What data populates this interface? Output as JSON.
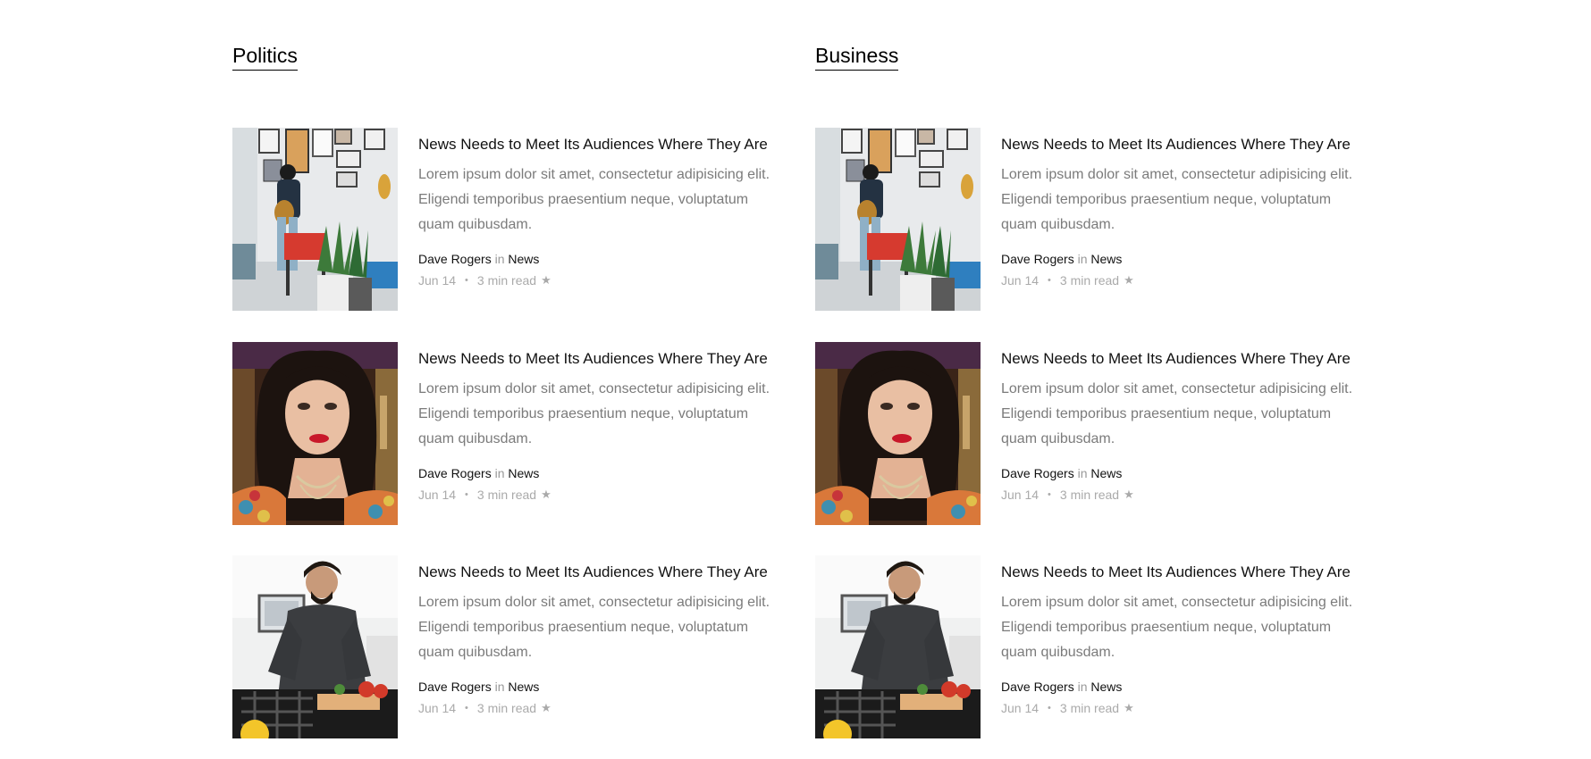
{
  "sections": [
    {
      "title": "Politics",
      "posts": [
        {
          "image": "woman-gallery-photo",
          "title": "News Needs to Meet Its Audiences Where They Are",
          "excerpt": "Lorem ipsum dolor sit amet, consectetur adipisicing elit. Eligendi temporibus praesentium neque, voluptatum quam quibusdam.",
          "author": "Dave Rogers",
          "in": "in",
          "category": "News",
          "date": "Jun 14",
          "separator": "•",
          "read_time": "3 min read",
          "star_icon": "star-icon"
        },
        {
          "image": "woman-portrait-photo",
          "title": "News Needs to Meet Its Audiences Where They Are",
          "excerpt": "Lorem ipsum dolor sit amet, consectetur adipisicing elit. Eligendi temporibus praesentium neque, voluptatum quam quibusdam.",
          "author": "Dave Rogers",
          "in": "in",
          "category": "News",
          "date": "Jun 14",
          "separator": "•",
          "read_time": "3 min read",
          "star_icon": "star-icon"
        },
        {
          "image": "man-cooking-photo",
          "title": "News Needs to Meet Its Audiences Where They Are",
          "excerpt": "Lorem ipsum dolor sit amet, consectetur adipisicing elit. Eligendi temporibus praesentium neque, voluptatum quam quibusdam.",
          "author": "Dave Rogers",
          "in": "in",
          "category": "News",
          "date": "Jun 14",
          "separator": "•",
          "read_time": "3 min read",
          "star_icon": "star-icon"
        }
      ]
    },
    {
      "title": "Business",
      "posts": [
        {
          "image": "woman-gallery-photo",
          "title": "News Needs to Meet Its Audiences Where They Are",
          "excerpt": "Lorem ipsum dolor sit amet, consectetur adipisicing elit. Eligendi temporibus praesentium neque, voluptatum quam quibusdam.",
          "author": "Dave Rogers",
          "in": "in",
          "category": "News",
          "date": "Jun 14",
          "separator": "•",
          "read_time": "3 min read",
          "star_icon": "star-icon"
        },
        {
          "image": "woman-portrait-photo",
          "title": "News Needs to Meet Its Audiences Where They Are",
          "excerpt": "Lorem ipsum dolor sit amet, consectetur adipisicing elit. Eligendi temporibus praesentium neque, voluptatum quam quibusdam.",
          "author": "Dave Rogers",
          "in": "in",
          "category": "News",
          "date": "Jun 14",
          "separator": "•",
          "read_time": "3 min read",
          "star_icon": "star-icon"
        },
        {
          "image": "man-cooking-photo",
          "title": "News Needs to Meet Its Audiences Where They Are",
          "excerpt": "Lorem ipsum dolor sit amet, consectetur adipisicing elit. Eligendi temporibus praesentium neque, voluptatum quam quibusdam.",
          "author": "Dave Rogers",
          "in": "in",
          "category": "News",
          "date": "Jun 14",
          "separator": "•",
          "read_time": "3 min read",
          "star_icon": "star-icon"
        }
      ]
    }
  ]
}
